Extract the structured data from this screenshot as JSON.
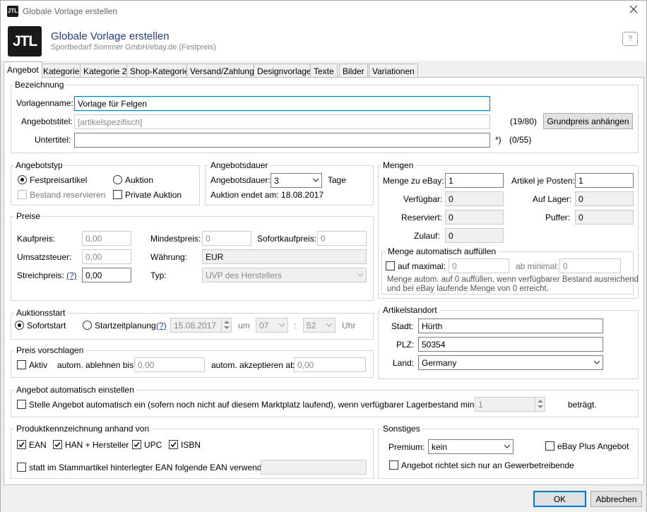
{
  "window": {
    "title": "Globale Vorlage erstellen"
  },
  "header": {
    "logo": "JTL",
    "title": "Globale Vorlage erstellen",
    "subtitle": "Sportbedarf Sommer GmbH/ebay.de (Festpreis)"
  },
  "tabs": [
    "Angebot",
    "Kategorie",
    "Kategorie 2",
    "Shop-Kategorie",
    "Versand/Zahlung",
    "Designvorlage",
    "Texte",
    "Bilder",
    "Variationen"
  ],
  "bezeichnung": {
    "legend": "Bezeichnung",
    "vorlagenname_label": "Vorlagenname:",
    "vorlagenname_value": "Vorlage für Felgen",
    "angebotstitel_label": "Angebotstitel:",
    "angebotstitel_placeholder": "[artikelspezifisch]",
    "angebotstitel_count": "(19/80)",
    "grundpreis_button": "Grundpreis anhängen",
    "untertitel_label": "Untertitel:",
    "untertitel_value": "",
    "untertitel_marker": "*)",
    "untertitel_count": "(0/55)"
  },
  "angebotstyp": {
    "legend": "Angebotstyp",
    "festpreis": "Festpreisartikel",
    "auktion": "Auktion",
    "bestand": "Bestand reservieren",
    "private": "Private Auktion"
  },
  "angebotsdauer": {
    "legend": "Angebotsdauer",
    "label": "Angebotsdauer:",
    "value": "3",
    "unit": "Tage",
    "ende": "Auktion endet am: 18.08.2017"
  },
  "preise": {
    "legend": "Preise",
    "kaufpreis_label": "Kaufpreis:",
    "kaufpreis": "0,00",
    "mindestpreis_label": "Mindestpreis:",
    "mindestpreis": "0",
    "sofortkaufpreis_label": "Sofortkaufpreis:",
    "sofortkaufpreis": "0",
    "umsatzsteuer_label": "Umsatzsteuer:",
    "umsatzsteuer": "0,00",
    "waehrung_label": "Währung:",
    "waehrung": "EUR",
    "streichpreis_label": "Streichpreis:",
    "help": "(?)",
    "streichpreis": "0,00",
    "typ_label": "Typ:",
    "typ": "UVP des Herstellers"
  },
  "mengen": {
    "legend": "Mengen",
    "zu_ebay_label": "Menge zu eBay:",
    "zu_ebay": "1",
    "je_posten_label": "Artikel je Posten:",
    "je_posten": "1",
    "verfuegbar_label": "Verfügbar:",
    "verfuegbar": "0",
    "auf_lager_label": "Auf Lager:",
    "auf_lager": "0",
    "reserviert_label": "Reserviert:",
    "reserviert": "0",
    "puffer_label": "Puffer:",
    "puffer": "0",
    "zulauf_label": "Zulauf:",
    "zulauf": "0",
    "auto_legend": "Menge automatisch auffüllen",
    "auf_maximal": "auf maximal:",
    "auf_maximal_value": "0",
    "ab_minimal": "ab minimal:",
    "ab_minimal_value": "0",
    "note_line1": "Menge autom. auf 0 auffüllen, wenn verfügbarer Bestand ausreichend",
    "note_line2": "und bei eBay laufende Menge von 0 erreicht."
  },
  "auktionsstart": {
    "legend": "Auktionsstart",
    "sofortstart": "Sofortstart",
    "startzeit": "Startzeitplanung",
    "help": "(?)",
    "datum": "15.08.2017",
    "um": "um",
    "stunde": "07",
    "colon": ":",
    "minute": "52",
    "uhr": "Uhr"
  },
  "artikelstandort": {
    "legend": "Artikelstandort",
    "stadt_label": "Stadt:",
    "stadt": "Hürth",
    "plz_label": "PLZ:",
    "plz": "50354",
    "land_label": "Land:",
    "land": "Germany"
  },
  "preis_vorschlagen": {
    "legend": "Preis vorschlagen",
    "aktiv": "Aktiv",
    "ablehnen_label": "autom. ablehnen bis:",
    "ablehnen": "0,00",
    "akzeptieren_label": "autom. akzeptieren ab:",
    "akzeptieren": "0,00"
  },
  "auto_einstellen": {
    "legend": "Angebot automatisch einstellen",
    "text": "Stelle Angebot automatisch ein (sofern noch nicht auf diesem Marktplatz laufend), wenn verfügbarer Lagerbestand mindestens",
    "value": "1",
    "suffix": "beträgt."
  },
  "produktkennzeichnung": {
    "legend": "Produktkennzeichnung anhand von",
    "ean": "EAN",
    "han": "HAN + Hersteller",
    "upc": "UPC",
    "isbn": "ISBN",
    "stamm": "statt im Stammartikel hinterlegter EAN folgende EAN verwenden:",
    "stamm_value": ""
  },
  "sonstiges": {
    "legend": "Sonstiges",
    "premium_label": "Premium:",
    "premium": "kein",
    "ebay_plus": "eBay Plus Angebot",
    "gewerbe": "Angebot richtet sich nur an Gewerbetreibende"
  },
  "footer": {
    "ok": "OK",
    "abbrechen": "Abbrechen"
  }
}
